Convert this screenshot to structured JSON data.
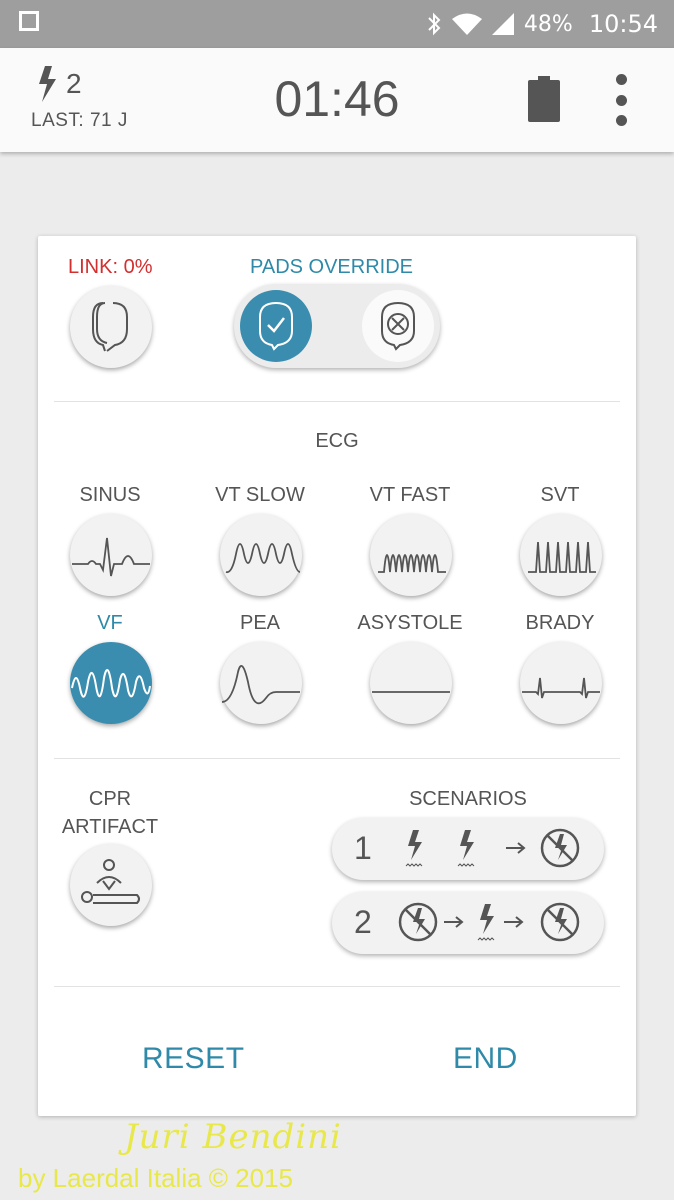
{
  "status_bar": {
    "battery_percent": "48%",
    "time": "10:54",
    "icons": [
      "square-icon",
      "bluetooth-icon",
      "wifi-icon",
      "signal-icon"
    ]
  },
  "header": {
    "shock_count": "2",
    "last_energy": "LAST: 71 J",
    "timer": "01:46",
    "icons": [
      "lightning-icon",
      "battery-icon",
      "overflow-menu-icon"
    ]
  },
  "pads": {
    "link_label": "LINK: 0%",
    "override_label": "PADS OVERRIDE",
    "override_state": "on"
  },
  "ecg": {
    "title": "ECG",
    "rhythms": [
      {
        "label": "SINUS",
        "active": false
      },
      {
        "label": "VT SLOW",
        "active": false
      },
      {
        "label": "VT FAST",
        "active": false
      },
      {
        "label": "SVT",
        "active": false
      },
      {
        "label": "VF",
        "active": true
      },
      {
        "label": "PEA",
        "active": false
      },
      {
        "label": "ASYSTOLE",
        "active": false
      },
      {
        "label": "BRADY",
        "active": false
      }
    ]
  },
  "cpr": {
    "label_line1": "CPR",
    "label_line2": "ARTIFACT"
  },
  "scenarios": {
    "title": "SCENARIOS",
    "items": [
      {
        "number": "1",
        "sequence": [
          "shock",
          "shock",
          "arrow",
          "no-shock"
        ]
      },
      {
        "number": "2",
        "sequence": [
          "no-shock",
          "arrow",
          "shock",
          "arrow",
          "no-shock"
        ]
      }
    ]
  },
  "actions": {
    "reset": "RESET",
    "end": "END"
  },
  "watermark": {
    "signature": "Juri Bendini",
    "copyright": "by Laerdal Italia © 2015"
  },
  "colors": {
    "accent": "#3a8daf",
    "warning": "#d32f2f",
    "watermark": "#e8e84a"
  }
}
